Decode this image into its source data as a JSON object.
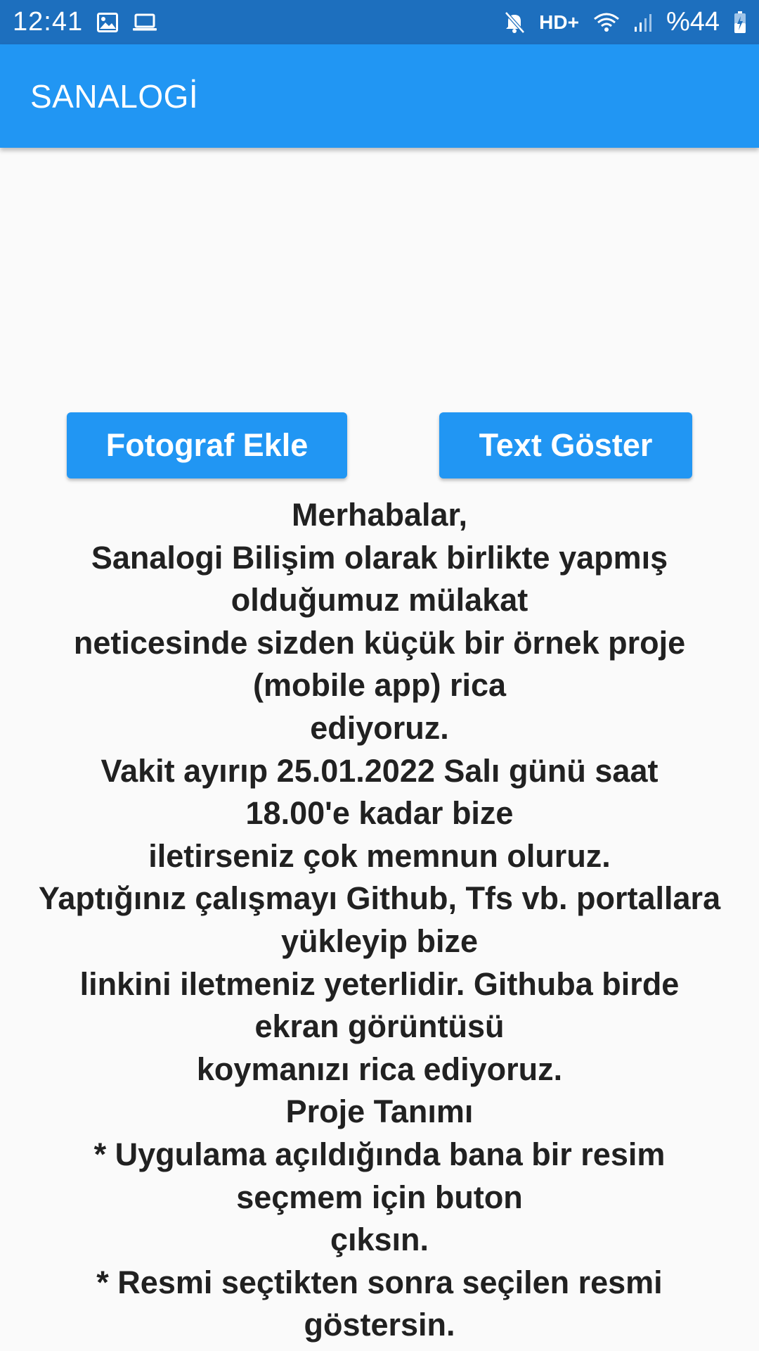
{
  "status_bar": {
    "time": "12:41",
    "network": "HD+",
    "battery": "%44",
    "left_icons": [
      "image-icon",
      "laptop-icon"
    ],
    "right_icons": [
      "mute-icon",
      "wifi-icon",
      "signal-icon",
      "battery-charging-icon"
    ]
  },
  "app_bar": {
    "title": "SANALOGİ",
    "color": "#2196f3"
  },
  "buttons": {
    "add_photo": "Fotograf Ekle",
    "show_text": "Text Göster"
  },
  "message": {
    "lines": [
      "Merhabalar,",
      "Sanalogi Bilişim olarak birlikte yapmış",
      "olduğumuz mülakat",
      "neticesinde sizden küçük bir örnek proje",
      "(mobile app) rica",
      "ediyoruz.",
      "Vakit ayırıp 25.01.2022 Salı günü saat",
      "18.00'e kadar bize",
      "iletirseniz çok memnun oluruz.",
      "Yaptığınız çalışmayı Github, Tfs vb. portallara",
      "yükleyip bize",
      "linkini iletmeniz yeterlidir. Githuba birde",
      "ekran görüntüsü",
      "koymanızı rica ediyoruz.",
      "Proje Tanımı",
      "* Uygulama açıldığında bana bir resim",
      "seçmem için buton",
      "çıksın.",
      "* Resmi seçtikten sonra seçilen resmi",
      "göstersin."
    ]
  }
}
